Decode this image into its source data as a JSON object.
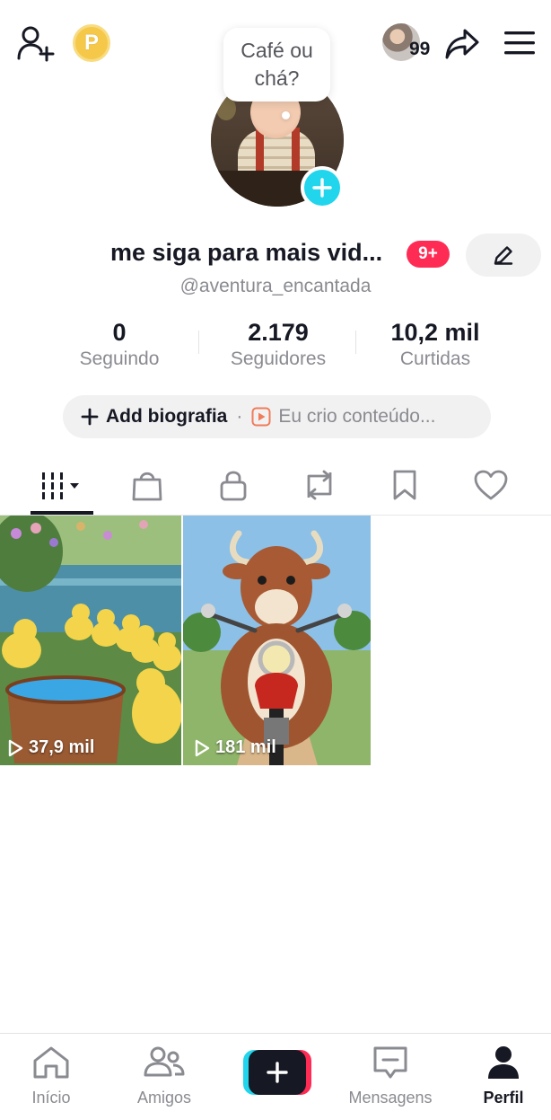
{
  "header": {
    "add_friend_icon": "person-plus-icon",
    "coin_label": "P",
    "visitors_count": "99",
    "share_icon": "share-arrow-icon",
    "menu_icon": "hamburger-menu-icon"
  },
  "profile": {
    "bubble_text": "Café ou chá?",
    "display_name": "me siga para mais vid...",
    "notification_badge": "9+",
    "username": "@aventura_encantada"
  },
  "stats": [
    {
      "value": "0",
      "label": "Seguindo"
    },
    {
      "value": "2.179",
      "label": "Seguidores"
    },
    {
      "value": "10,2 mil",
      "label": "Curtidas"
    }
  ],
  "bio": {
    "add_label": "Add biografia",
    "separator": "·",
    "creator_label": "Eu crio conteúdo..."
  },
  "tabs": [
    {
      "name": "videos",
      "icon": "grid-videos-icon",
      "active": true
    },
    {
      "name": "shop",
      "icon": "shopping-bag-icon"
    },
    {
      "name": "private",
      "icon": "lock-icon"
    },
    {
      "name": "reposts",
      "icon": "repost-icon"
    },
    {
      "name": "saved",
      "icon": "bookmark-icon"
    },
    {
      "name": "liked",
      "icon": "heart-icon"
    }
  ],
  "videos": [
    {
      "views": "37,9 mil"
    },
    {
      "views": "181 mil"
    }
  ],
  "bottom_nav": [
    {
      "label": "Início",
      "icon": "home-icon"
    },
    {
      "label": "Amigos",
      "icon": "friends-icon"
    },
    {
      "label": "",
      "icon": "create-plus-icon"
    },
    {
      "label": "Mensagens",
      "icon": "message-icon"
    },
    {
      "label": "Perfil",
      "icon": "profile-icon",
      "active": true
    }
  ],
  "colors": {
    "accent_red": "#fe2c55",
    "accent_cyan": "#20d5ec",
    "text_primary": "#161823",
    "text_secondary": "#8a8b91"
  }
}
